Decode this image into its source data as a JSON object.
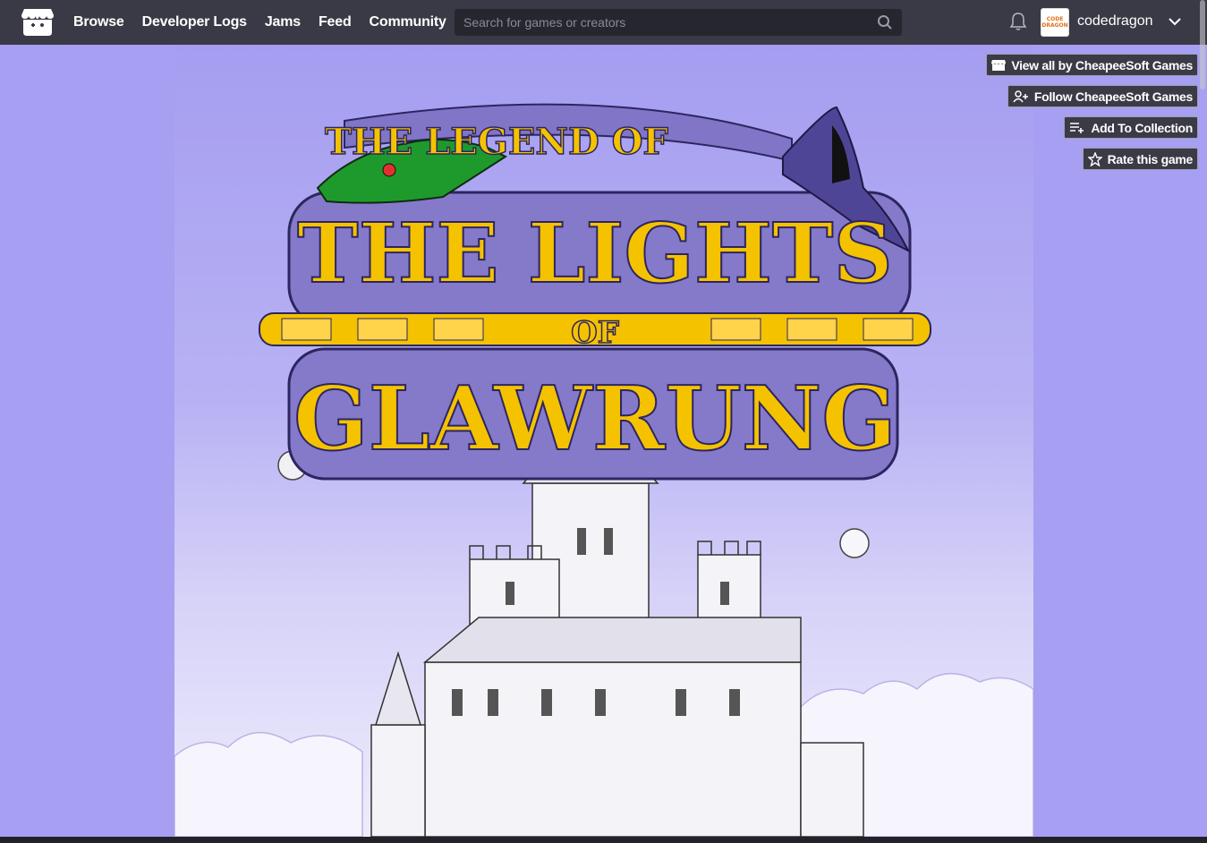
{
  "header": {
    "nav": [
      "Browse",
      "Developer Logs",
      "Jams",
      "Feed",
      "Community"
    ],
    "search_placeholder": "Search for games or creators",
    "username": "codedragon",
    "avatar_text": "CODE DRAGON"
  },
  "actions": {
    "view_all": "View all by CheapeeSoft Games",
    "follow": "Follow CheapeeSoft Games",
    "add_collection": "Add To Collection",
    "rate": "Rate this game"
  },
  "cover": {
    "title_line1": "THE LEGEND OF",
    "title_line2": "THE LIGHTS",
    "title_line3": "OF",
    "title_line4": "GLAWRUNG"
  },
  "colors": {
    "header_bg": "#3a3a46",
    "page_bg": "#a79ff2",
    "title_yellow": "#f5c200",
    "banner_purple": "#7d72c4"
  }
}
